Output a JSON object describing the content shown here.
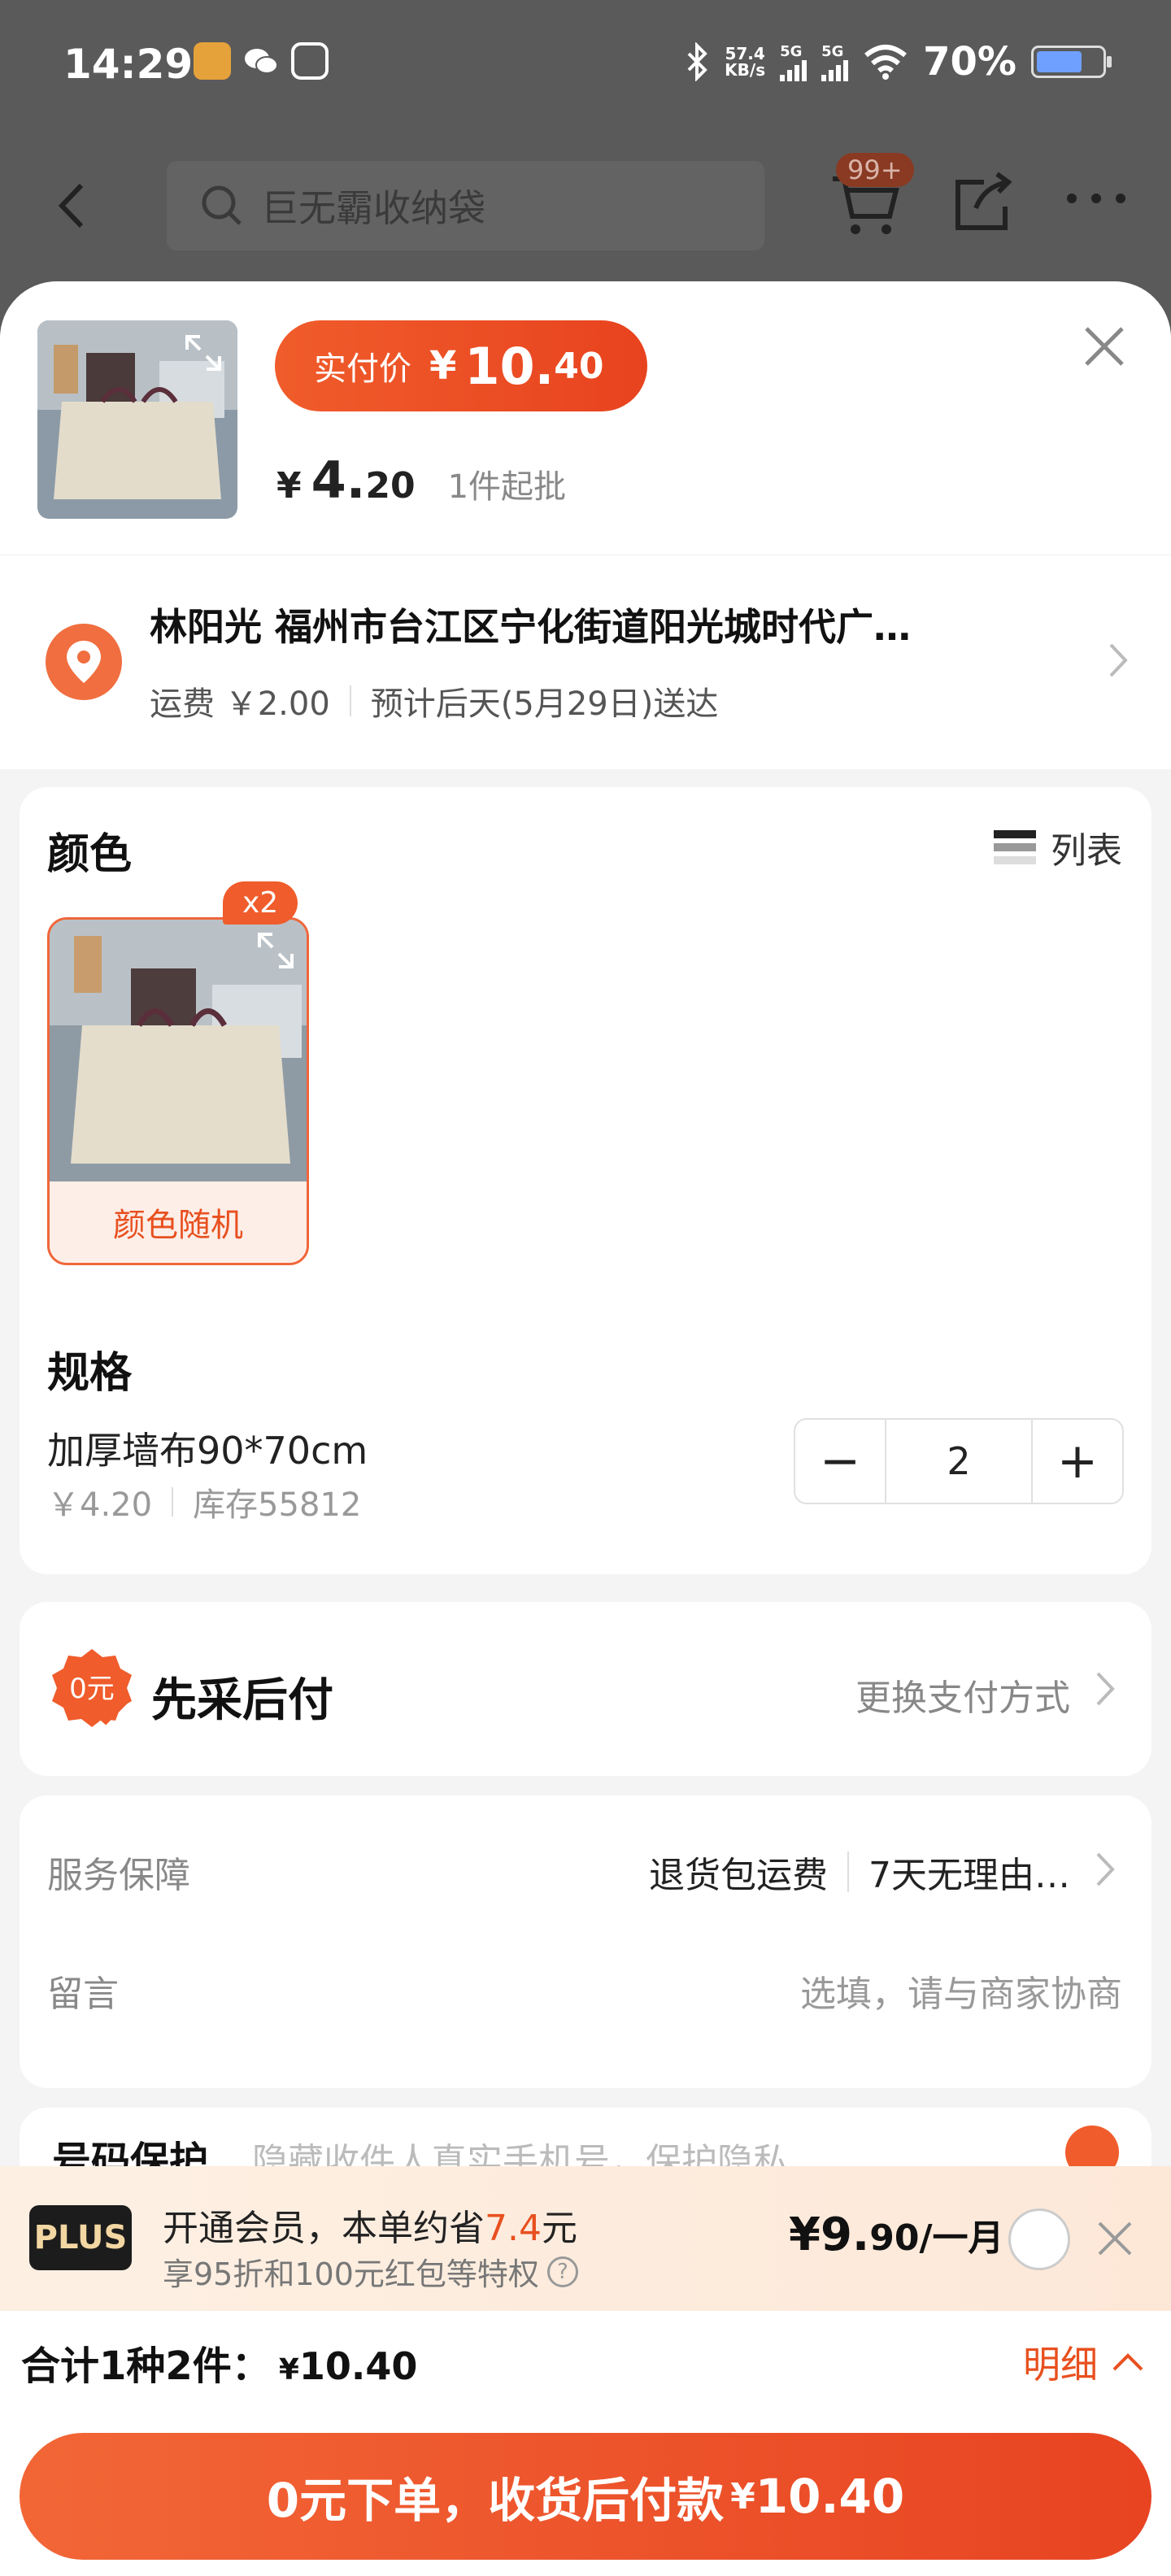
{
  "status_bar": {
    "time": "14:29",
    "net_speed_top": "57.4",
    "net_speed_bottom": "KB/s",
    "sim1": "5G",
    "sim2": "5G",
    "battery": "70%"
  },
  "background_nav": {
    "search_placeholder": "巨无霸收纳袋",
    "cart_badge": "99+"
  },
  "sheet_header": {
    "paid_price_label": "实付价",
    "paid_currency": "¥",
    "paid_int": "10.",
    "paid_dec": "40",
    "unit_currency": "¥",
    "unit_int": "4.",
    "unit_dec": "20",
    "moq": "1件起批"
  },
  "address": {
    "line1": "林阳光 福州市台江区宁化街道阳光城时代广…",
    "shipping": "运费 ￥2.00",
    "eta": "预计后天(5月29日)送达"
  },
  "spec_card": {
    "color_title": "颜色",
    "list_toggle_label": "列表",
    "swatch_name": "颜色随机",
    "swatch_qty": "x2",
    "spec_title": "规格",
    "spec_name": "加厚墙布90*70cm",
    "spec_price": "￥4.20",
    "spec_stock": "库存55812",
    "quantity": "2",
    "minus": "−",
    "plus": "+"
  },
  "payment": {
    "title": "先采后付",
    "change_label": "更换支付方式"
  },
  "service": {
    "label": "服务保障",
    "tag1": "退货包运费",
    "tag2": "7天无理由…",
    "note_label": "留言",
    "note_placeholder": "选填，请与商家协商"
  },
  "privacy": {
    "title": "号码保护",
    "desc": "隐藏收件人真实手机号，保护隐私"
  },
  "plus_banner": {
    "logo": "PLUS",
    "line1_prefix": "开通会员，本单约省",
    "save_amount": "7.4",
    "line1_suffix": "元",
    "line2": "享95折和100元红包等特权",
    "price_main": "¥9.",
    "price_dec": "90",
    "price_suffix": "/一月"
  },
  "footer": {
    "total_label": "合计1种2件：",
    "total_currency": "¥",
    "total_amount": "10.40",
    "detail_label": "明细",
    "submit_main": "0元下单，收货后付款",
    "submit_currency": "¥",
    "submit_amount": "10.40"
  },
  "colors": {
    "accent": "#f05c2b",
    "accent_dark": "#e8431f",
    "sheet_bg": "#f4f4f4"
  }
}
